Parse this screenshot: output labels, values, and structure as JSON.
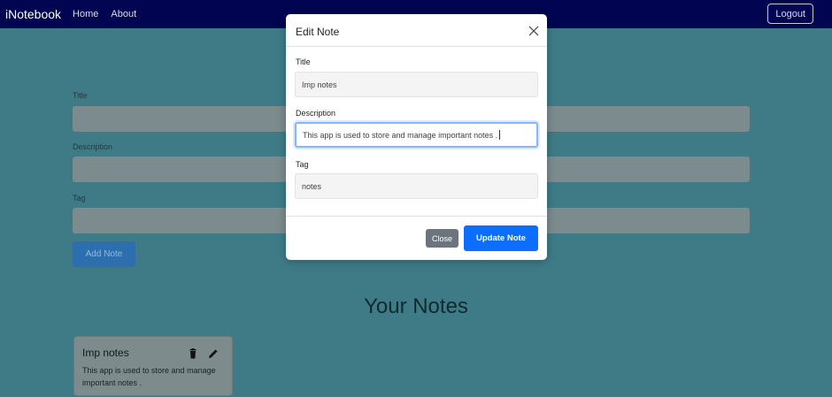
{
  "navbar": {
    "brand": "iNotebook",
    "links": [
      "Home",
      "About"
    ],
    "logout_label": "Logout"
  },
  "add_form": {
    "title_label": "Title",
    "description_label": "Description",
    "tag_label": "Tag",
    "add_button_label": "Add Note"
  },
  "notes_section": {
    "heading": "Your Notes",
    "notes": [
      {
        "title": "Imp notes",
        "description": "This app is used to store and manage important notes ."
      }
    ]
  },
  "modal": {
    "title": "Edit Note",
    "title_label": "Title",
    "title_value": "Imp notes",
    "description_label": "Description",
    "description_value": "This app is used to store and manage important notes .",
    "tag_label": "Tag",
    "tag_value": "notes",
    "close_label": "Close",
    "update_label": "Update Note"
  },
  "icons": [
    "close-icon",
    "trash-icon",
    "pencil-icon"
  ],
  "colors": {
    "navbar": "#000451",
    "backdrop": "#3e7b87",
    "primary": "#0d6efd",
    "secondary": "#6c757d"
  }
}
